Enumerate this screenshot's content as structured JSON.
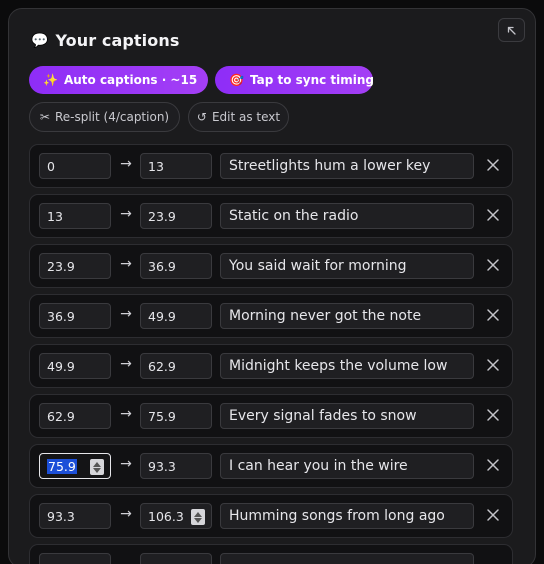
{
  "panel": {
    "title_emoji": "💬",
    "title": "Your captions"
  },
  "actions": {
    "auto_emoji": "✨",
    "auto_label": "Auto captions · ~15",
    "sync_emoji": "🎯",
    "sync_label": "Tap to sync timing",
    "resplit_icon": "✂",
    "resplit_label": "Re-split (4/caption)",
    "edit_icon": "↺",
    "edit_label": "Edit as text"
  },
  "arrow_glyph": "→",
  "captions": [
    {
      "start": "0",
      "end": "13",
      "text": "Streetlights hum a lower key"
    },
    {
      "start": "13",
      "end": "23.9",
      "text": "Static on the radio"
    },
    {
      "start": "23.9",
      "end": "36.9",
      "text": "You said wait for morning"
    },
    {
      "start": "36.9",
      "end": "49.9",
      "text": "Morning never got the note"
    },
    {
      "start": "49.9",
      "end": "62.9",
      "text": "Midnight keeps the volume low"
    },
    {
      "start": "62.9",
      "end": "75.9",
      "text": "Every signal fades to snow"
    },
    {
      "start": "75.9",
      "end": "93.3",
      "text": "I can hear you in the wire"
    },
    {
      "start": "93.3",
      "end": "106.3",
      "text": "Humming songs from long ago"
    }
  ],
  "icons": {
    "collapse": "collapse-arrow-icon",
    "delete": "close-icon",
    "coin": "coin-icon"
  },
  "colors": {
    "accent": "#9b35f6",
    "panel_bg": "#1b1b1d",
    "row_bg": "#111113",
    "selection": "#1c4fd8"
  }
}
